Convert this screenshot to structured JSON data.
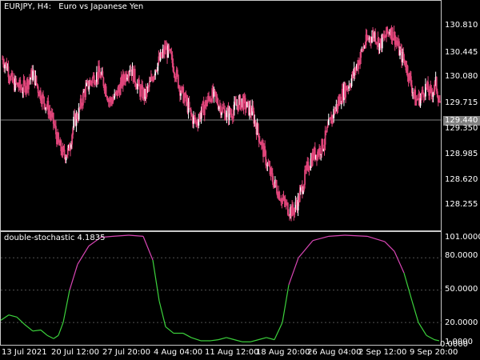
{
  "main_title": {
    "symbol": "EURJPY, H4:",
    "description": "Euro vs Japanese Yen"
  },
  "indicator_title": "double-stochastic 4.1835",
  "current_price": "129.440",
  "price_axis_labels": [
    "130.810",
    "130.445",
    "130.080",
    "129.715",
    "129.350",
    "128.985",
    "128.620",
    "128.255"
  ],
  "indicator_axis_labels": [
    "101.0000",
    "80.0000",
    "50.0000",
    "20.0000",
    "1.0000",
    "0.0000"
  ],
  "time_axis_labels": [
    "13 Jul 2021",
    "20 Jul 12:00",
    "27 Jul 20:00",
    "4 Aug 04:00",
    "11 Aug 12:00",
    "18 Aug 20:00",
    "26 Aug 04:00",
    "2 Sep 12:00",
    "9 Sep 20:00"
  ],
  "colors": {
    "candle": "#e0457a",
    "candle_light": "#ffffff",
    "osc_high": "#d946b5",
    "osc_low": "#3cd23c",
    "level_line": "#505050"
  },
  "price_close": [
    130.3,
    130.18,
    129.96,
    129.92,
    129.88,
    129.98,
    130.1,
    129.88,
    129.72,
    129.6,
    129.4,
    129.1,
    128.95,
    129.0,
    129.4,
    129.55,
    129.82,
    129.95,
    130.05,
    130.1,
    129.95,
    129.7,
    129.75,
    129.9,
    130.05,
    130.2,
    130.02,
    129.85,
    129.78,
    129.95,
    130.18,
    130.3,
    130.45,
    130.32,
    130.1,
    129.85,
    129.7,
    129.5,
    129.4,
    129.55,
    129.68,
    129.8,
    129.72,
    129.6,
    129.52,
    129.55,
    129.66,
    129.7,
    129.62,
    129.55,
    129.3,
    129.05,
    128.8,
    128.6,
    128.45,
    128.3,
    128.2,
    128.15,
    128.3,
    128.55,
    128.8,
    128.95,
    129.0,
    129.1,
    129.35,
    129.55,
    129.7,
    129.85,
    129.95,
    130.1,
    130.3,
    130.5,
    130.6,
    130.65,
    130.5,
    130.6,
    130.72,
    130.6,
    130.38,
    130.25,
    130.0,
    129.72,
    129.75,
    129.9,
    129.8,
    129.95,
    129.62
  ]
}
